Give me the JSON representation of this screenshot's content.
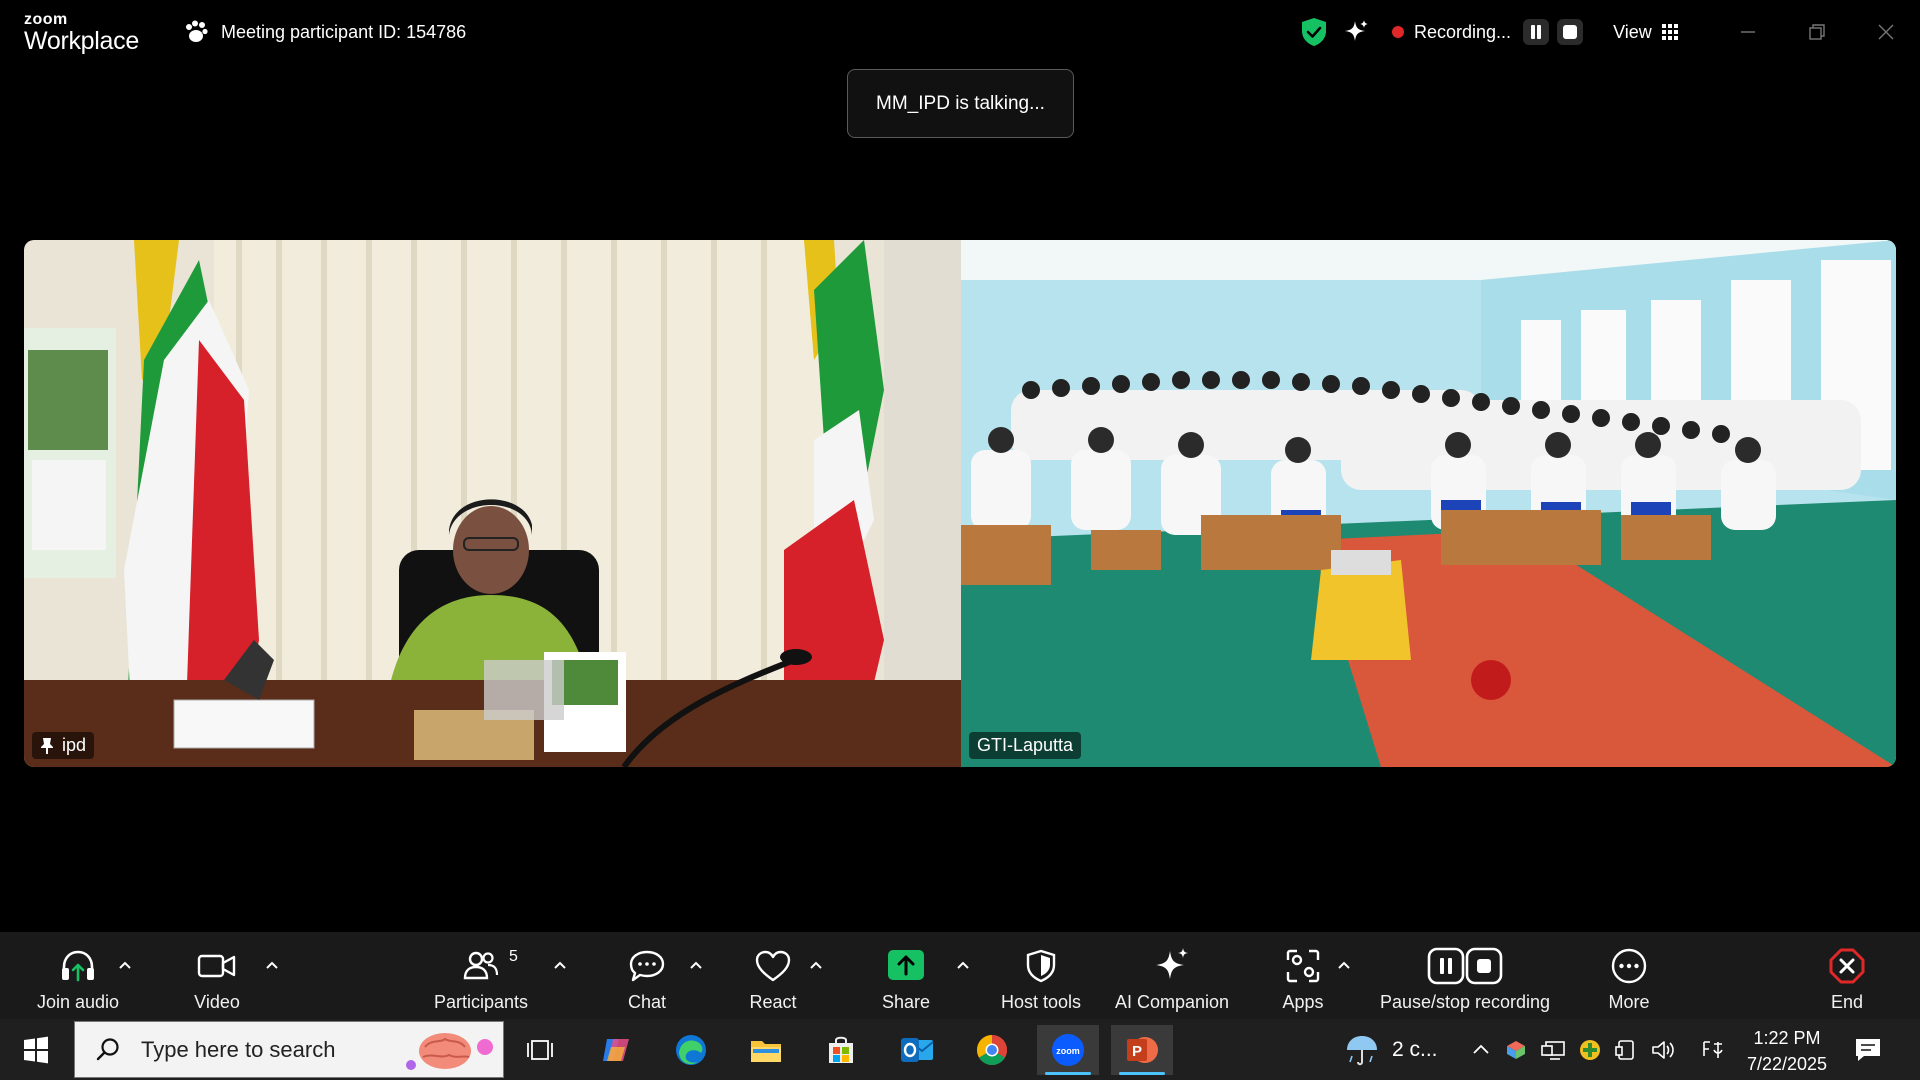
{
  "app": {
    "logo_top": "zoom",
    "logo_bottom": "Workplace",
    "meeting_id_label": "Meeting participant ID: 154786"
  },
  "recording": {
    "status": "Recording...",
    "view_label": "View"
  },
  "banner": {
    "talking": "MM_IPD is talking..."
  },
  "tiles": [
    {
      "name": "ipd",
      "pinned": true
    },
    {
      "name": "GTI-Laputta",
      "pinned": false
    }
  ],
  "toolbar": {
    "join_audio": "Join audio",
    "video": "Video",
    "participants": "Participants",
    "participants_count": "5",
    "chat": "Chat",
    "react": "React",
    "share": "Share",
    "host_tools": "Host tools",
    "ai_companion": "AI Companion",
    "apps": "Apps",
    "pause_stop": "Pause/stop recording",
    "more": "More",
    "end": "End"
  },
  "taskbar": {
    "search_placeholder": "Type here to search",
    "weather": "2 c...",
    "time": "1:22 PM",
    "date": "7/22/2025"
  },
  "colors": {
    "accent_green": "#16c163",
    "end_red": "#e02828",
    "taskbar_active": "#4cc2ff"
  }
}
